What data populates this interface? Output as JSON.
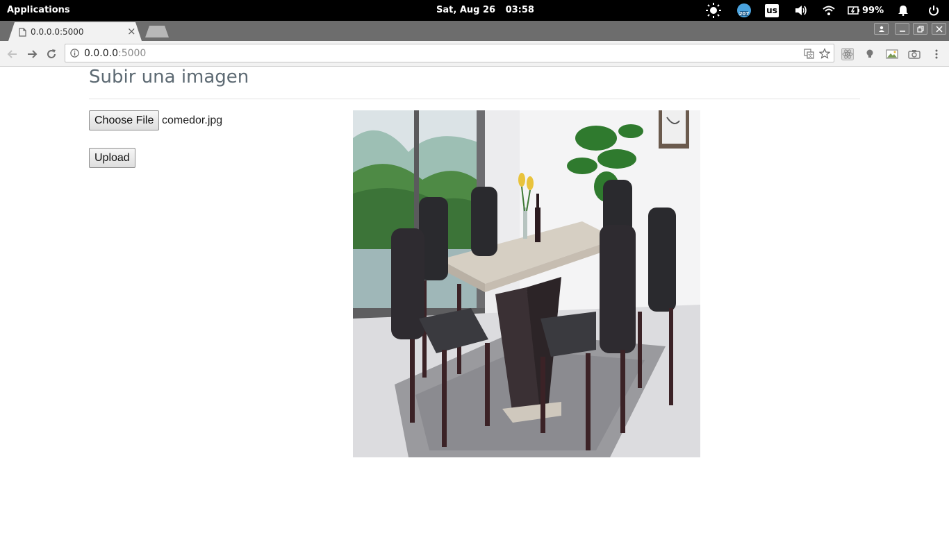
{
  "system_panel": {
    "applications_label": "Applications",
    "date": "Sat, Aug 26",
    "time": "03:58",
    "calendar_badge": "207",
    "keyboard_layout": "us",
    "battery": "99%"
  },
  "browser": {
    "tab_title": "0.0.0.0:5000",
    "url_host": "0.0.0.0",
    "url_port": ":5000"
  },
  "page": {
    "heading": "Subir una imagen",
    "choose_file_label": "Choose File",
    "selected_file": "comedor.jpg",
    "upload_label": "Upload"
  },
  "colors": {
    "panel": "#000000",
    "tabstrip": "#6d6d6d",
    "toolbar": "#f2f2f2",
    "heading": "#5d6a73"
  }
}
